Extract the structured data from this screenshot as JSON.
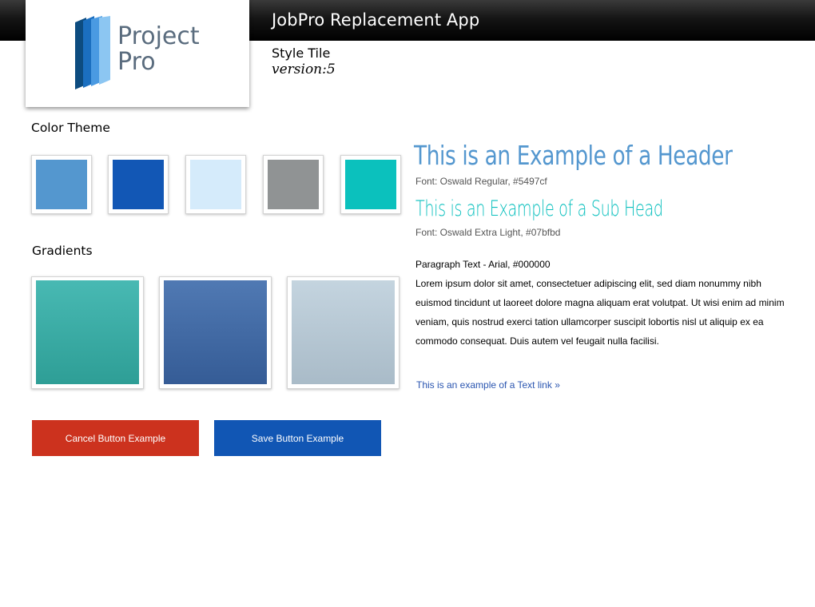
{
  "app": {
    "title": "JobPro Replacement App"
  },
  "logo": {
    "line1": "Project",
    "line2": "Pro"
  },
  "tile": {
    "name": "Style Tile",
    "version": "version:5"
  },
  "color_theme": {
    "label": "Color Theme",
    "swatches": [
      "#5497cf",
      "#1257b5",
      "#d5ebfb",
      "#909394",
      "#0bc1bd"
    ]
  },
  "gradients": {
    "label": "Gradients",
    "tiles": [
      {
        "from": "#48b9b3",
        "to": "#2e9e96"
      },
      {
        "from": "#5079b3",
        "to": "#355c96"
      },
      {
        "from": "#c4d4df",
        "to": "#a9bbc8"
      }
    ]
  },
  "buttons": {
    "cancel_label": "Cancel Button Example",
    "cancel_color": "#cc321e",
    "save_label": "Save Button Example",
    "save_color": "#1156b4"
  },
  "typography": {
    "header_text": "This is an Example of a Header",
    "header_note": "Font: Oswald Regular, #5497cf",
    "subhead_text": "This is an Example of a Sub Head",
    "subhead_note": "Font: Oswald Extra Light, #07bfbd",
    "paragraph_label": "Paragraph Text - Arial, #000000",
    "paragraph": "Lorem ipsum dolor sit amet, consectetuer adipiscing elit, sed diam nonummy nibh euismod tincidunt ut laoreet dolore magna aliquam erat volutpat. Ut wisi enim ad minim veniam, quis nostrud exerci tation ullamcorper suscipit lobortis nisl ut aliquip ex ea commodo consequat. Duis autem vel feugait nulla facilisi.",
    "link_text": "This is an example of a Text link »"
  }
}
